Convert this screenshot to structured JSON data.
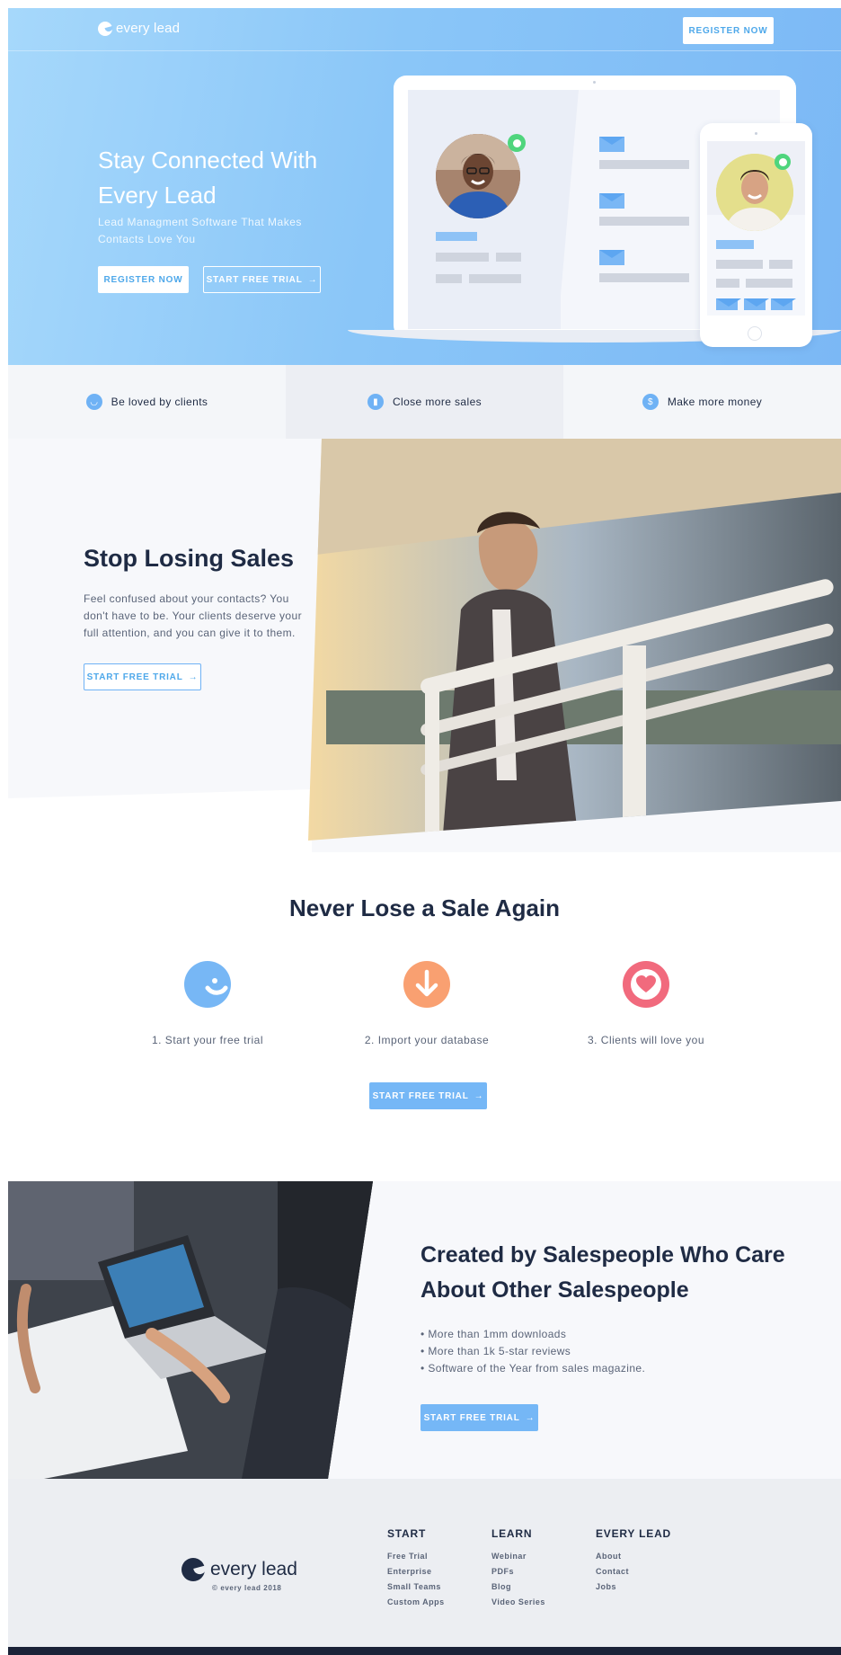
{
  "header": {
    "logo_text": "every lead",
    "register_label": "REGISTER NOW"
  },
  "hero": {
    "title": "Stay Connected With Every Lead",
    "subtitle": "Lead Managment Software That Makes Contacts Love You",
    "register_label": "REGISTER NOW",
    "trial_label": "START FREE TRIAL"
  },
  "features": [
    {
      "label": "Be loved by clients",
      "icon": "smile-icon"
    },
    {
      "label": "Close more sales",
      "icon": "chart-icon"
    },
    {
      "label": "Make more money",
      "icon": "dollar-icon",
      "glyph": "$"
    }
  ],
  "stop": {
    "title": "Stop Losing Sales",
    "text": "Feel confused about your contacts? You don't have to be. Your clients deserve your full attention, and you can give it to them.",
    "trial_label": "START FREE TRIAL"
  },
  "never": {
    "title": "Never Lose a Sale Again",
    "steps": [
      {
        "label": "1. Start your free trial",
        "icon": "smile-icon",
        "color": "#77b7f5"
      },
      {
        "label": "2. Import your database",
        "icon": "arrow-down-icon",
        "color": "#f9a071"
      },
      {
        "label": "3. Clients will love you",
        "icon": "heart-icon",
        "color": "#f16a7d"
      }
    ],
    "trial_label": "START FREE TRIAL"
  },
  "created": {
    "title": "Created by Salespeople Who Care About Other Salespeople",
    "bullets": [
      "More than 1mm downloads",
      "More than 1k 5-star reviews",
      "Software of the Year from sales magazine."
    ],
    "trial_label": "START FREE TRIAL"
  },
  "footer": {
    "logo_text": "every lead",
    "copyright": "© every lead 2018",
    "columns": [
      {
        "title": "START",
        "links": [
          "Free Trial",
          "Enterprise",
          "Small Teams",
          "Custom Apps"
        ]
      },
      {
        "title": "LEARN",
        "links": [
          "Webinar",
          "PDFs",
          "Blog",
          "Video Series"
        ]
      },
      {
        "title": "EVERY LEAD",
        "links": [
          "About",
          "Contact",
          "Jobs"
        ]
      }
    ]
  },
  "colors": {
    "accent": "#75b7f6",
    "dark": "#1f2b44",
    "green": "#4fd57d"
  }
}
